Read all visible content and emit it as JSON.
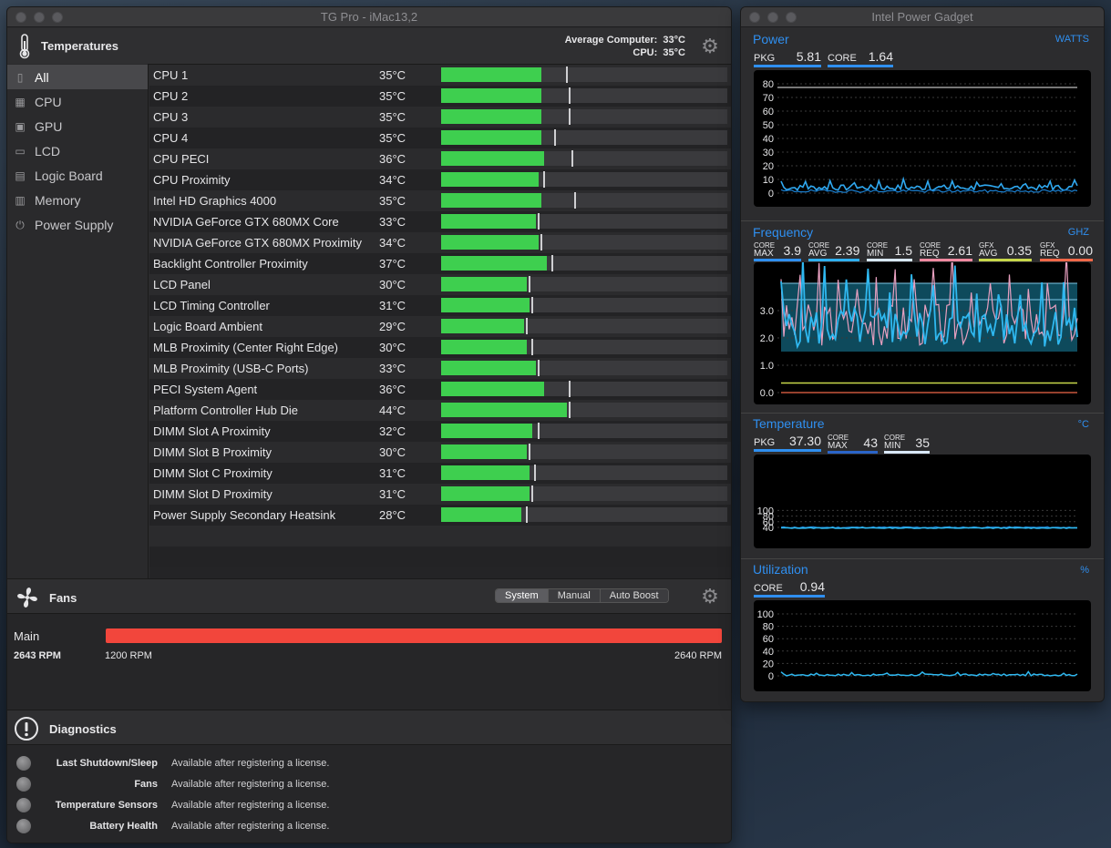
{
  "tg": {
    "title": "TG Pro - iMac13,2",
    "temperatures": {
      "title": "Temperatures",
      "avg_label": "Average Computer:",
      "avg_value": "33°C",
      "cpu_label": "CPU:",
      "cpu_value": "35°C"
    },
    "sidebar": [
      {
        "label": "All",
        "icon": "computer-icon"
      },
      {
        "label": "CPU",
        "icon": "cpu-chip-icon"
      },
      {
        "label": "GPU",
        "icon": "gpu-chip-icon"
      },
      {
        "label": "LCD",
        "icon": "display-icon"
      },
      {
        "label": "Logic Board",
        "icon": "logic-board-icon"
      },
      {
        "label": "Memory",
        "icon": "memory-icon"
      },
      {
        "label": "Power Supply",
        "icon": "power-icon"
      }
    ],
    "sensors": [
      {
        "name": "CPU 1",
        "temp": "35°C",
        "level": 35,
        "max": 43
      },
      {
        "name": "CPU 2",
        "temp": "35°C",
        "level": 35,
        "max": 44
      },
      {
        "name": "CPU 3",
        "temp": "35°C",
        "level": 35,
        "max": 44
      },
      {
        "name": "CPU 4",
        "temp": "35°C",
        "level": 35,
        "max": 39
      },
      {
        "name": "CPU PECI",
        "temp": "36°C",
        "level": 36,
        "max": 45
      },
      {
        "name": "CPU Proximity",
        "temp": "34°C",
        "level": 34,
        "max": 35
      },
      {
        "name": "Intel HD Graphics 4000",
        "temp": "35°C",
        "level": 35,
        "max": 46
      },
      {
        "name": "NVIDIA GeForce GTX 680MX Core",
        "temp": "33°C",
        "level": 33,
        "max": 33
      },
      {
        "name": "NVIDIA GeForce GTX 680MX Proximity",
        "temp": "34°C",
        "level": 34,
        "max": 34
      },
      {
        "name": "Backlight Controller Proximity",
        "temp": "37°C",
        "level": 37,
        "max": 38
      },
      {
        "name": "LCD Panel",
        "temp": "30°C",
        "level": 30,
        "max": 30
      },
      {
        "name": "LCD Timing Controller",
        "temp": "31°C",
        "level": 31,
        "max": 31
      },
      {
        "name": "Logic Board Ambient",
        "temp": "29°C",
        "level": 29,
        "max": 29
      },
      {
        "name": "MLB Proximity (Center Right Edge)",
        "temp": "30°C",
        "level": 30,
        "max": 31
      },
      {
        "name": "MLB Proximity (USB-C Ports)",
        "temp": "33°C",
        "level": 33,
        "max": 33
      },
      {
        "name": "PECI System Agent",
        "temp": "36°C",
        "level": 36,
        "max": 44
      },
      {
        "name": "Platform Controller Hub Die",
        "temp": "44°C",
        "level": 44,
        "max": 44
      },
      {
        "name": "DIMM Slot A Proximity",
        "temp": "32°C",
        "level": 32,
        "max": 33
      },
      {
        "name": "DIMM Slot B Proximity",
        "temp": "30°C",
        "level": 30,
        "max": 30
      },
      {
        "name": "DIMM Slot C Proximity",
        "temp": "31°C",
        "level": 31,
        "max": 32
      },
      {
        "name": "DIMM Slot D Proximity",
        "temp": "31°C",
        "level": 31,
        "max": 31
      },
      {
        "name": "Power Supply Secondary Heatsink",
        "temp": "28°C",
        "level": 28,
        "max": 29
      }
    ],
    "fans": {
      "title": "Fans",
      "modes": [
        "System",
        "Manual",
        "Auto Boost"
      ],
      "active_mode": "System",
      "fan_name": "Main",
      "current": "2643 RPM",
      "min": "1200 RPM",
      "max": "2640 RPM",
      "fill_fraction": 1.0,
      "bar_color": "#f2463c"
    },
    "diagnostics": {
      "title": "Diagnostics",
      "items": [
        {
          "label": "Last Shutdown/Sleep",
          "value": "Available after registering a license."
        },
        {
          "label": "Fans",
          "value": "Available after registering a license."
        },
        {
          "label": "Temperature Sensors",
          "value": "Available after registering a license."
        },
        {
          "label": "Battery Health",
          "value": "Available after registering a license."
        }
      ]
    }
  },
  "ipg": {
    "title": "Intel Power Gadget",
    "accent": "#2f8ff0",
    "power": {
      "title": "Power",
      "unit": "WATTS",
      "pkg_label": "PKG",
      "pkg_value": "5.81",
      "core_label": "CORE",
      "core_value": "1.64",
      "yticks": [
        "80",
        "70",
        "60",
        "50",
        "40",
        "30",
        "20",
        "10",
        "0"
      ]
    },
    "frequency": {
      "title": "Frequency",
      "unit": "GHZ",
      "stats": [
        {
          "top": "CORE",
          "bottom": "MAX",
          "value": "3.9",
          "color": "#2f8ff0"
        },
        {
          "top": "CORE",
          "bottom": "AVG",
          "value": "2.39",
          "color": "#2fb0f0"
        },
        {
          "top": "CORE",
          "bottom": "MIN",
          "value": "1.5",
          "color": "#d8e8f8"
        },
        {
          "top": "CORE",
          "bottom": "REQ",
          "value": "2.61",
          "color": "#f08aa0"
        },
        {
          "top": "GFX",
          "bottom": "AVG",
          "value": "0.35",
          "color": "#c8d84a"
        },
        {
          "top": "GFX",
          "bottom": "REQ",
          "value": "0.00",
          "color": "#f06848"
        }
      ],
      "yticks": [
        "3.0",
        "2.0",
        "1.0",
        "0.0"
      ]
    },
    "temperature": {
      "title": "Temperature",
      "unit": "°C",
      "pkg_label": "PKG",
      "pkg_value": "37.30",
      "max_top": "CORE",
      "max_bottom": "MAX",
      "max_value": "43",
      "min_top": "CORE",
      "min_bottom": "MIN",
      "min_value": "35",
      "yticks": [
        "100",
        "80",
        "60",
        "40"
      ]
    },
    "utilization": {
      "title": "Utilization",
      "unit": "%",
      "core_label": "CORE",
      "core_value": "0.94",
      "yticks": [
        "100",
        "80",
        "60",
        "40",
        "20",
        "0"
      ]
    }
  }
}
